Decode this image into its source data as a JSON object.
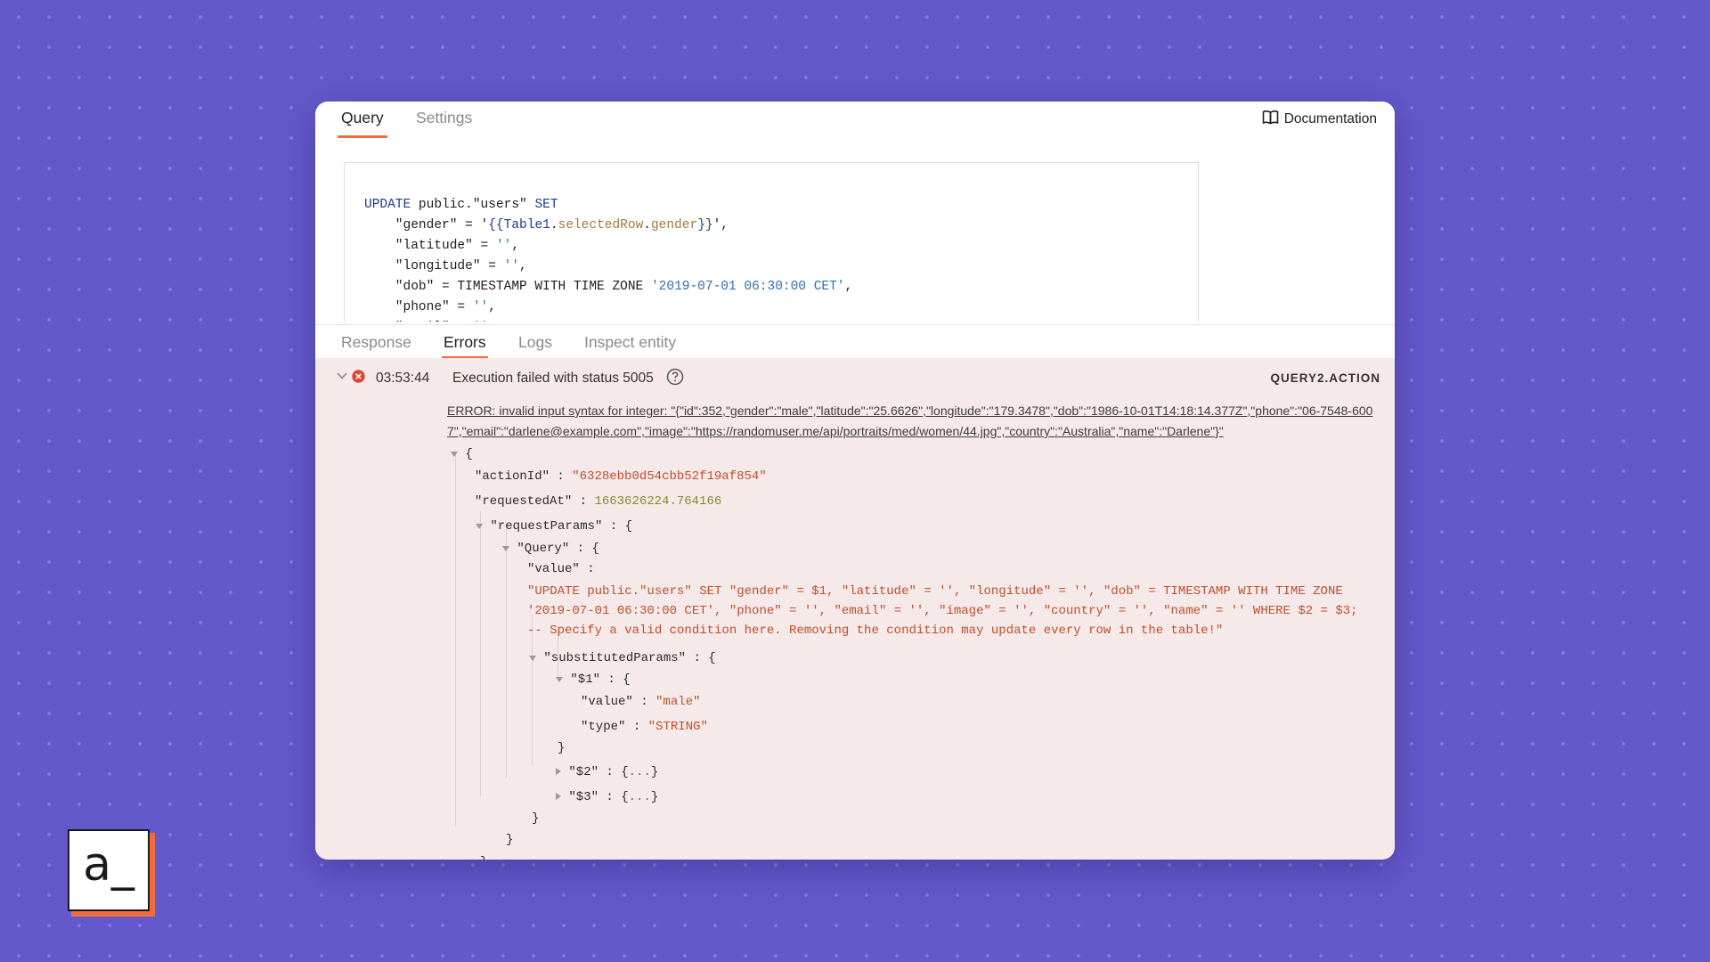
{
  "top_tabs": {
    "query": "Query",
    "settings": "Settings"
  },
  "documentation_label": "Documentation",
  "code_lines": [
    [
      "UPDATE public.\"users\" SET"
    ],
    [
      "    \"gender\" = '{{Table1.selectedRow.gender}}',"
    ],
    [
      "    \"latitude\" = '',"
    ],
    [
      "    \"longitude\" = '',"
    ],
    [
      "    \"dob\" = TIMESTAMP WITH TIME ZONE '2019-07-01 06:30:00 CET',"
    ],
    [
      "    \"phone\" = '',"
    ],
    [
      "    \"email\" = '',"
    ]
  ],
  "bottom_tabs": {
    "response": "Response",
    "errors": "Errors",
    "logs": "Logs",
    "inspect": "Inspect entity"
  },
  "error_header": {
    "time": "03:53:44",
    "message": "Execution failed with status 5005",
    "action": "QUERY2.ACTION"
  },
  "error_text": "ERROR: invalid input syntax for integer: \"{\"id\":352,\"gender\":\"male\",\"latitude\":\"25.6626\",\"longitude\":\"179.3478\",\"dob\":\"1986-10-01T14:18:14.377Z\",\"phone\":\"06-7548-6007\",\"email\":\"darlene@example.com\",\"image\":\"https://randomuser.me/api/portraits/med/women/44.jpg\",\"country\":\"Australia\",\"name\":\"Darlene\"}\"",
  "json": {
    "open_brace": "{",
    "actionId_key": "\"actionId\"",
    "actionId_val": "\"6328ebb0d54cbb52f19af854\"",
    "requestedAt_key": "\"requestedAt\"",
    "requestedAt_val": "1663626224.764166",
    "requestParams_key": "\"requestParams\"",
    "query_key": "\"Query\"",
    "value_key": "\"value\"",
    "query_value": "\"UPDATE public.\"users\" SET \"gender\" = $1, \"latitude\" = '', \"longitude\" = '', \"dob\" = TIMESTAMP WITH TIME ZONE '2019-07-01 06:30:00 CET', \"phone\" = '', \"email\" = '', \"image\" = '', \"country\" = '', \"name\" = '' WHERE $2 = $3; -- Specify a valid condition here. Removing the condition may update every row in the table!\"",
    "substitutedParams_key": "\"substitutedParams\"",
    "p1_key": "\"$1\"",
    "p1_value_key": "\"value\"",
    "p1_value_val": "\"male\"",
    "p1_type_key": "\"type\"",
    "p1_type_val": "\"STRING\"",
    "p2_key": "\"$2\"",
    "p3_key": "\"$3\"",
    "ellipsis": "...",
    "sep": " : ",
    "close_brace": "}"
  },
  "logo_text": "a_",
  "colors": {
    "background": "#6459cb",
    "accent": "#f26b3a",
    "error_bg": "#f6e9ea",
    "string": "#c04f29"
  }
}
